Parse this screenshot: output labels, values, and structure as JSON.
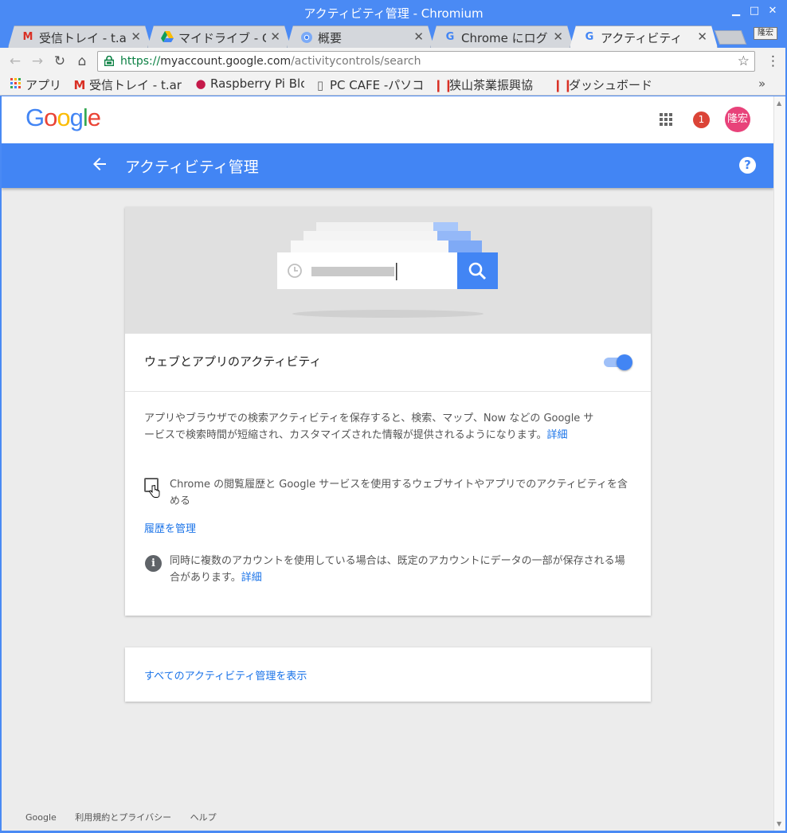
{
  "window": {
    "title": "アクティビティ管理 - Chromium"
  },
  "tabs": [
    {
      "label": "受信トレイ - t.ar",
      "icon": "gmail-icon"
    },
    {
      "label": "マイドライブ - G",
      "icon": "drive-icon"
    },
    {
      "label": "概要",
      "icon": "chromium-icon"
    },
    {
      "label": "Chrome にログイ",
      "icon": "google-icon"
    },
    {
      "label": "アクティビティ",
      "icon": "google-icon",
      "active": true
    }
  ],
  "profile_chip": "隆宏",
  "omnibox": {
    "scheme": "https://",
    "host": "myaccount.google.com",
    "path": "/activitycontrols/search"
  },
  "bookmarks": [
    {
      "label": "アプリ",
      "icon": "apps-grid-icon"
    },
    {
      "label": "受信トレイ - t.ar",
      "icon": "gmail-icon"
    },
    {
      "label": "Raspberry Pi Blo",
      "icon": "raspberry-icon"
    },
    {
      "label": "PC CAFE -パソコ",
      "icon": "page-icon"
    },
    {
      "label": "狭山茶業振興協",
      "icon": "red-bars-icon"
    },
    {
      "label": "ダッシュボード",
      "icon": "red-bars-icon"
    }
  ],
  "header": {
    "logo": "Google",
    "notification_count": "1",
    "avatar_text": "隆宏"
  },
  "bluebar": {
    "title": "アクティビティ管理",
    "help": "?"
  },
  "card": {
    "section_title": "ウェブとアプリのアクティビティ",
    "toggle_on": true,
    "description": "アプリやブラウザでの検索アクティビティを保存すると、検索、マップ、Now などの Google サービスで検索時間が短縮され、カスタマイズされた情報が提供されるようになります。",
    "description_link": "詳細",
    "checkbox_label": "Chrome の閲覧履歴と Google サービスを使用するウェブサイトやアプリでのアクティビティを含める",
    "checkbox_checked": false,
    "manage_history": "履歴を管理",
    "info_text": "同時に複数のアカウントを使用している場合は、既定のアカウントにデータの一部が保存される場合があります。",
    "info_link": "詳細"
  },
  "card2": {
    "link": "すべてのアクティビティ管理を表示"
  },
  "footer": {
    "items": [
      "Google",
      "利用規約とプライバシー",
      "ヘルプ"
    ]
  }
}
